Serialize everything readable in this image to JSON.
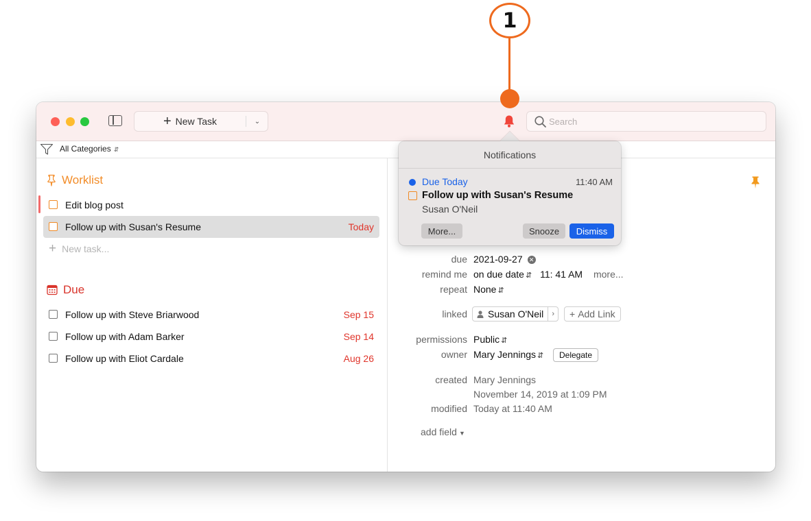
{
  "callout": {
    "number": "1"
  },
  "toolbar": {
    "new_task_label": "New Task",
    "search_placeholder": "Search",
    "accent_bell": "#f0453a"
  },
  "filter": {
    "label": "All Categories"
  },
  "worklist": {
    "title": "Worklist",
    "tasks": [
      {
        "title": "Edit blog post",
        "date": ""
      },
      {
        "title": "Follow up with Susan's Resume",
        "date": "Today"
      }
    ],
    "new_task_placeholder": "New task..."
  },
  "due": {
    "title": "Due",
    "tasks": [
      {
        "title": "Follow up with Steve Briarwood",
        "date": "Sep 15"
      },
      {
        "title": "Follow up with Adam Barker",
        "date": "Sep 14"
      },
      {
        "title": "Follow up with Eliot Cardale",
        "date": "Aug 26"
      }
    ]
  },
  "notification": {
    "header": "Notifications",
    "status": "Due Today",
    "time": "11:40 AM",
    "task": "Follow up with Susan's Resume",
    "person": "Susan O'Neil",
    "more_label": "More...",
    "snooze_label": "Snooze",
    "dismiss_label": "Dismiss"
  },
  "detail": {
    "due_label": "due",
    "due_value": "2021-09-27",
    "remind_label": "remind me",
    "remind_value": "on due date",
    "remind_time": "11: 41 AM",
    "remind_more": "more...",
    "repeat_label": "repeat",
    "repeat_value": "None",
    "linked_label": "linked",
    "linked_person": "Susan O'Neil",
    "add_link_label": "Add Link",
    "permissions_label": "permissions",
    "permissions_value": "Public",
    "owner_label": "owner",
    "owner_value": "Mary Jennings",
    "delegate_label": "Delegate",
    "created_label": "created",
    "created_by": "Mary Jennings",
    "created_date": "November 14, 2019 at 1:09 PM",
    "modified_label": "modified",
    "modified_value": "Today at 11:40 AM",
    "add_field_label": "add field"
  }
}
